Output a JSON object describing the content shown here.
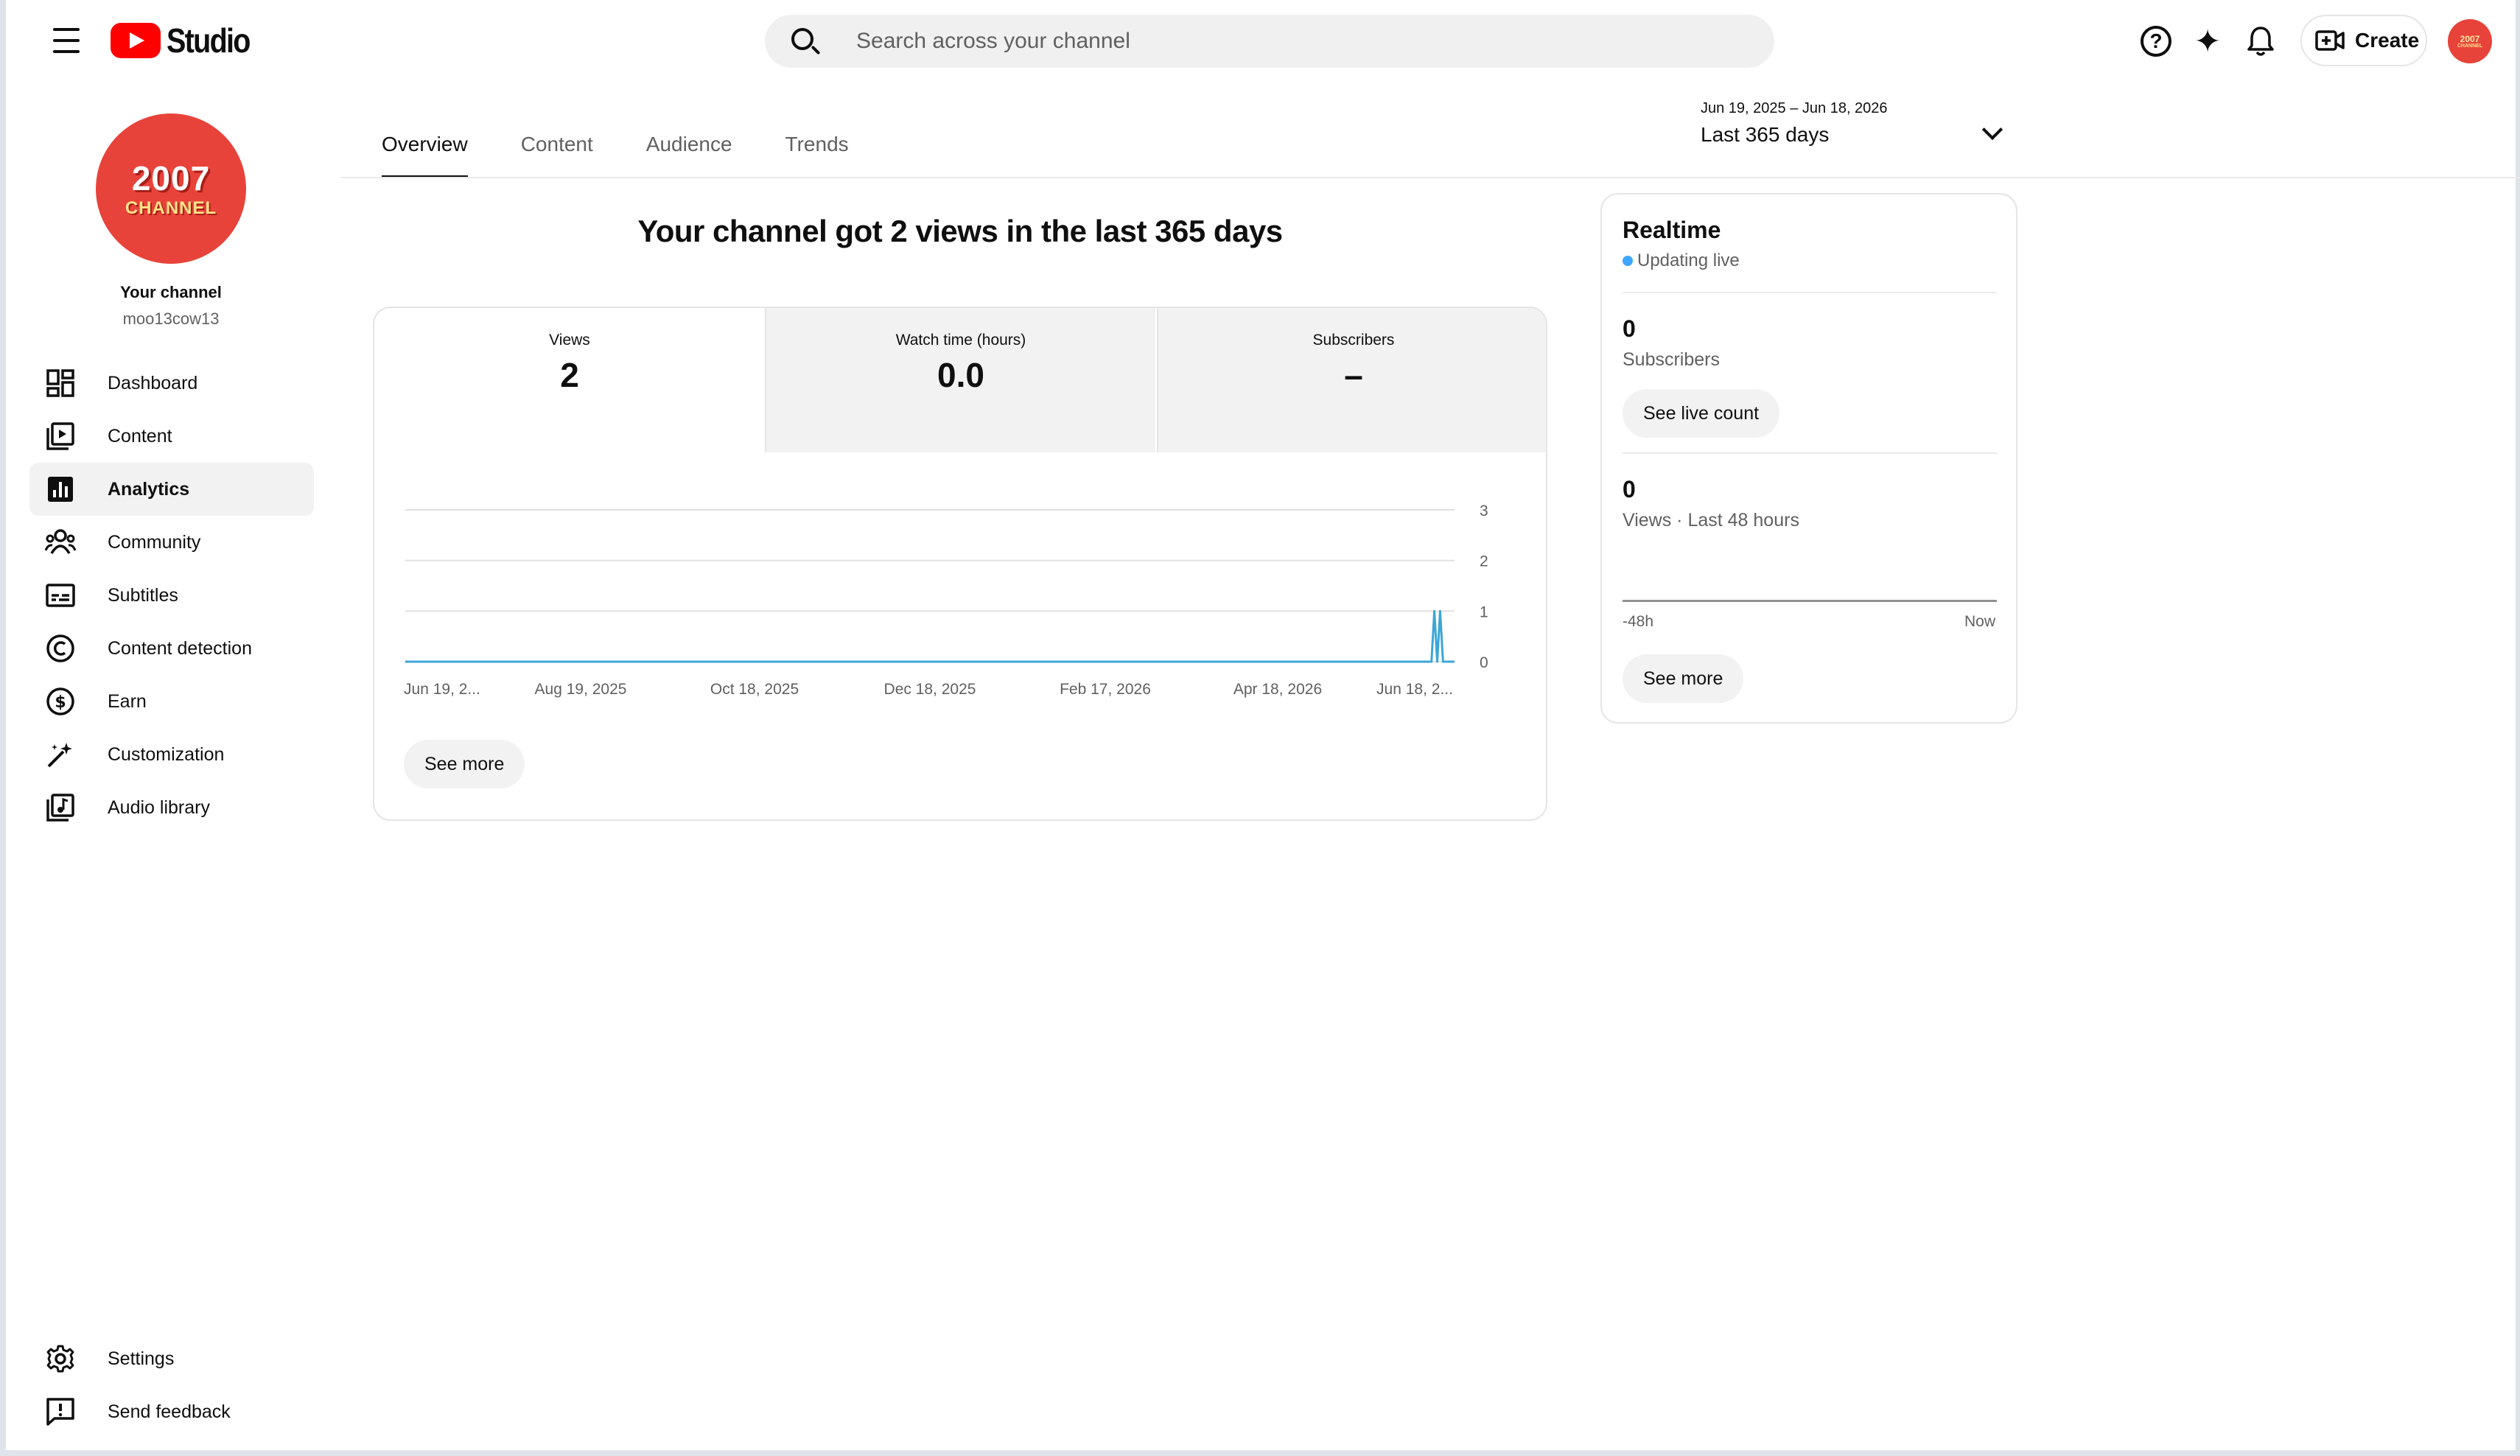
{
  "header": {
    "app_name": "Studio",
    "search_placeholder": "Search across your channel",
    "create_label": "Create",
    "avatar_text_1": "2007",
    "avatar_text_2": "CHANNEL"
  },
  "sidebar": {
    "channel_logo_line1": "2007",
    "channel_logo_line2": "CHANNEL",
    "channel_title": "Your channel",
    "channel_handle": "moo13cow13",
    "items": [
      {
        "label": "Dashboard",
        "icon": "dashboard-icon"
      },
      {
        "label": "Content",
        "icon": "content-icon"
      },
      {
        "label": "Analytics",
        "icon": "analytics-icon",
        "active": true
      },
      {
        "label": "Community",
        "icon": "community-icon"
      },
      {
        "label": "Subtitles",
        "icon": "subtitles-icon"
      },
      {
        "label": "Content detection",
        "icon": "copyright-icon"
      },
      {
        "label": "Earn",
        "icon": "dollar-icon"
      },
      {
        "label": "Customization",
        "icon": "magic-wand-icon"
      },
      {
        "label": "Audio library",
        "icon": "audio-library-icon"
      }
    ],
    "bottom_items": [
      {
        "label": "Settings",
        "icon": "gear-icon"
      },
      {
        "label": "Send feedback",
        "icon": "feedback-icon"
      }
    ]
  },
  "tabs": [
    {
      "label": "Overview",
      "active": true
    },
    {
      "label": "Content"
    },
    {
      "label": "Audience"
    },
    {
      "label": "Trends"
    }
  ],
  "date_picker": {
    "range": "Jun 19, 2025 – Jun 18, 2026",
    "label": "Last 365 days"
  },
  "headline": "Your channel got 2 views in the last 365 days",
  "metrics": [
    {
      "label": "Views",
      "value": "2",
      "selected": true
    },
    {
      "label": "Watch time (hours)",
      "value": "0.0"
    },
    {
      "label": "Subscribers",
      "value": "–"
    }
  ],
  "see_more_label": "See more",
  "chart_data": {
    "type": "line",
    "x_tick_labels": [
      "Jun 19, 2...",
      "Aug 19, 2025",
      "Oct 18, 2025",
      "Dec 18, 2025",
      "Feb 17, 2026",
      "Apr 18, 2026",
      "Jun 18, 2..."
    ],
    "y_ticks": [
      0,
      1,
      2,
      3
    ],
    "ylim": [
      0,
      3
    ],
    "x_range_days": [
      0,
      364
    ],
    "series": [
      {
        "points": [
          [
            0,
            0
          ],
          [
            356,
            0
          ],
          [
            357,
            1
          ],
          [
            358,
            0
          ],
          [
            359,
            1
          ],
          [
            360,
            0
          ],
          [
            364,
            0
          ]
        ]
      }
    ],
    "line_color": "#3ea6d6",
    "grid": true
  },
  "realtime": {
    "title": "Realtime",
    "status": "Updating live",
    "subscribers_value": "0",
    "subscribers_label": "Subscribers",
    "live_count_button": "See live count",
    "views_value": "0",
    "views_label": "Views · Last 48 hours",
    "axis_left": "-48h",
    "axis_right": "Now",
    "see_more_label": "See more"
  }
}
